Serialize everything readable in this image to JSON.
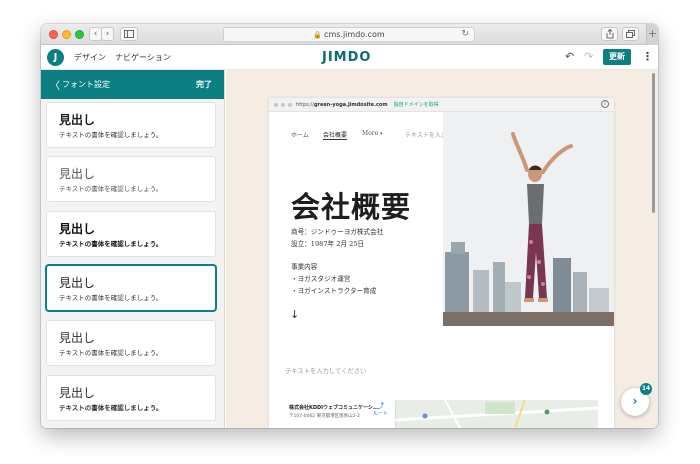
{
  "browser": {
    "url": "cms.jimdo.com",
    "new_tab": "+"
  },
  "toolbar": {
    "logo_letter": "J",
    "nav_design": "デザイン",
    "nav_navigation": "ナビゲーション",
    "brand": "JIMDO",
    "update_label": "更新"
  },
  "panel": {
    "back_arrow": "〈",
    "title": "フォント設定",
    "done_label": "完了",
    "items": [
      {
        "heading": "見出し",
        "sample": "テキストの書体を確認しましょう。"
      },
      {
        "heading": "見出し",
        "sample": "テキストの書体を確認しましょう。"
      },
      {
        "heading": "見出し",
        "sample": "テキストの書体を確認しましょう。"
      },
      {
        "heading": "見出し",
        "sample": "テキストの書体を確認しましょう。"
      },
      {
        "heading": "見出し",
        "sample": "テキストの書体を確認しましょう。"
      },
      {
        "heading": "見出し",
        "sample": "テキストの書体を確認しましょう。"
      }
    ],
    "selected_index": 3
  },
  "preview": {
    "site_url_prefix": "https://",
    "site_url_domain": "green-yoga.jimdosite.com",
    "domain_cta": "独自ドメインを取得",
    "nav": [
      "ホーム",
      "会社概要",
      "More",
      "テキストを入力してください"
    ],
    "active_nav": "会社概要",
    "page_title": "会社概要",
    "company_line1": "商号：ジンドゥーヨガ株式会社",
    "company_line2": "設立：1987年 2月 25日",
    "business_heading": "事業内容",
    "business_item1": "・ヨガスタジオ運営",
    "business_item2": "・ヨガインストラクター育成",
    "scroll_arrow": "↓",
    "placeholder": "テキストを入力してください",
    "map_company": "株式会社KDDIウェブコミュニケーシ...",
    "map_address": "〒107-0062 東京都港区南青山2-2",
    "map_route": "ルート"
  },
  "chat": {
    "badge_count": "14"
  },
  "colors": {
    "brand_teal": "#0b7f82",
    "content_bg": "#f5ece4",
    "cta_green": "#1aa87a"
  }
}
